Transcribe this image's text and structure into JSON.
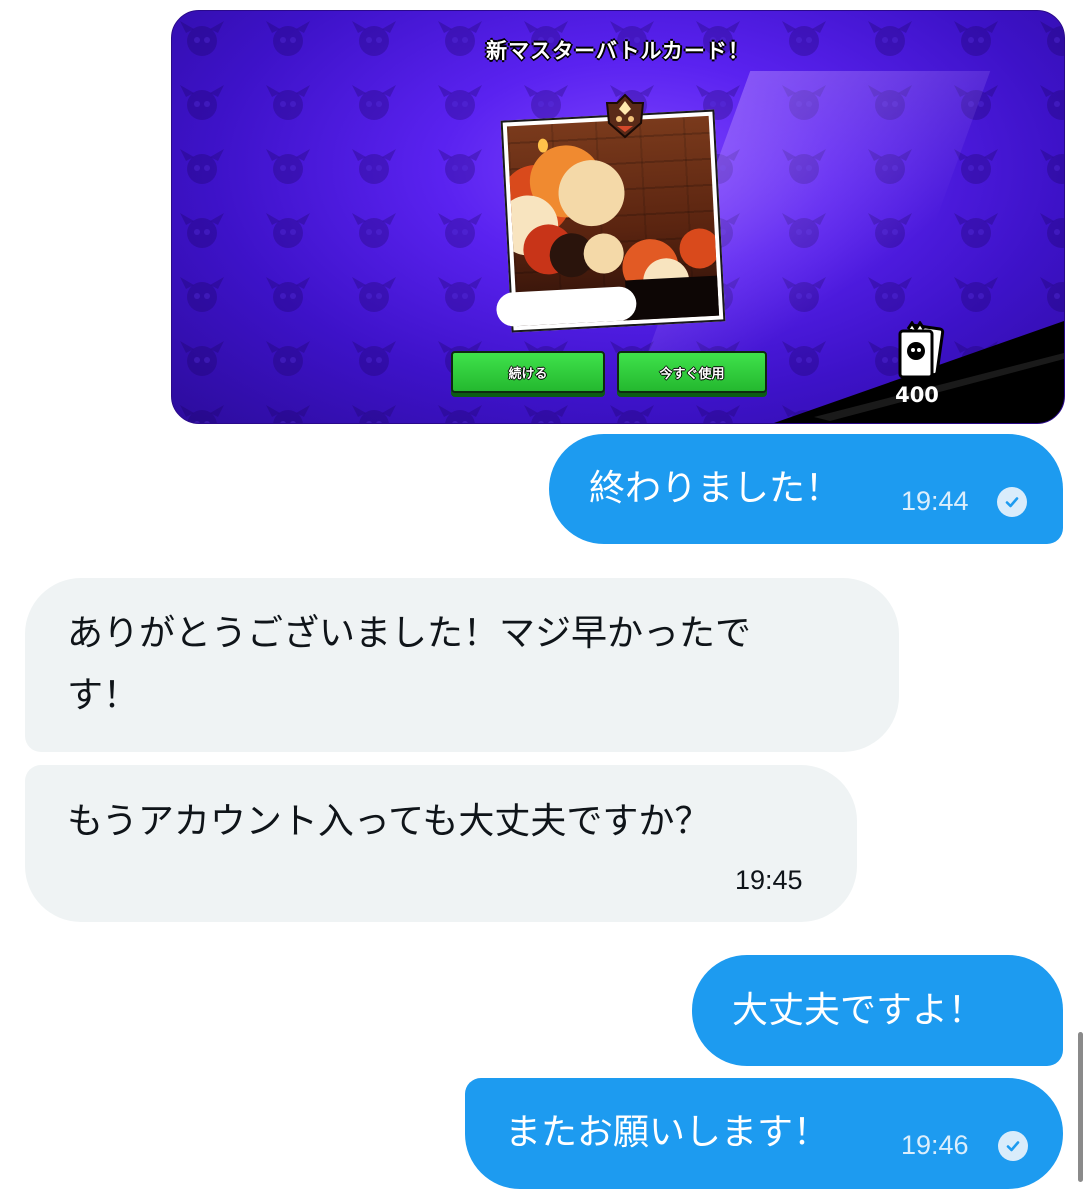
{
  "shared_image": {
    "game_title": "新マスターバトルカード！",
    "buttons": {
      "continue": "続ける",
      "use_now": "今すぐ使用"
    },
    "badge_count": "400",
    "colors": {
      "bg": "#4a1be0",
      "button": "#2fcf3c",
      "corner": "#000000"
    }
  },
  "messages": [
    {
      "side": "outgoing",
      "text": "終わりました！",
      "time": "19:44",
      "read": true
    },
    {
      "side": "incoming",
      "lines": [
        "ありがとうございました！マジ早かったで",
        "す！"
      ]
    },
    {
      "side": "incoming",
      "text": "もうアカウント入っても大丈夫ですか？",
      "time": "19:45"
    },
    {
      "side": "outgoing",
      "text": "大丈夫ですよ！"
    },
    {
      "side": "outgoing",
      "text": "またお願いします！",
      "time": "19:46",
      "read": true
    }
  ],
  "theme": {
    "outgoing_bubble": "#1d9bf0",
    "incoming_bubble": "#eff3f4"
  }
}
